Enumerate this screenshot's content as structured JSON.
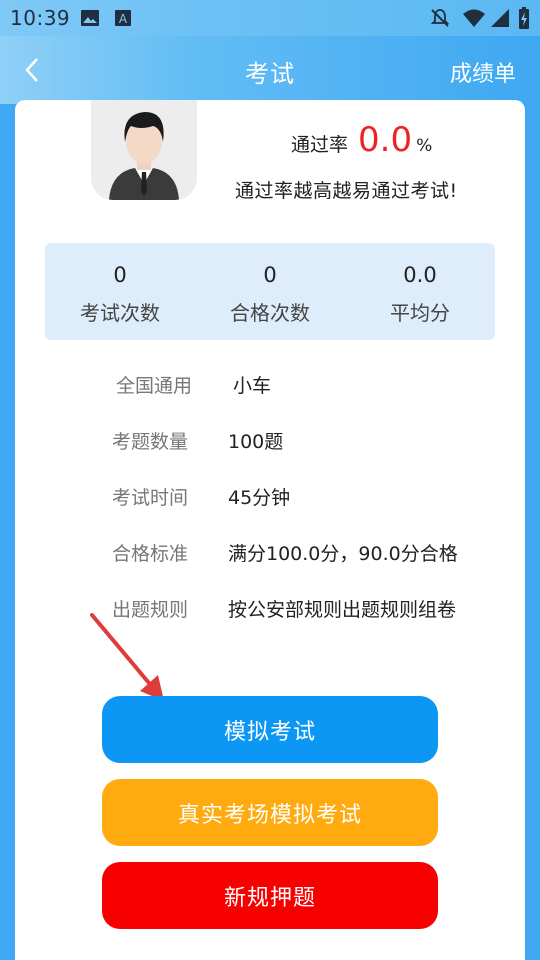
{
  "status_bar": {
    "time": "10:39",
    "icons": [
      "image-icon",
      "text-a-icon",
      "mute-bell-icon",
      "wifi-icon",
      "signal-icon",
      "battery-charging-icon"
    ]
  },
  "header": {
    "back_icon": "chevron-left-icon",
    "title": "考试",
    "right_label": "成绩单"
  },
  "profile": {
    "avatar_icon": "user-avatar",
    "pass_rate_label": "通过率",
    "pass_rate_value": "0.0",
    "pass_rate_unit": "%",
    "hint": "通过率越高越易通过考试!"
  },
  "stats": [
    {
      "value": "0",
      "label": "考试次数"
    },
    {
      "value": "0",
      "label": "合格次数"
    },
    {
      "value": "0.0",
      "label": "平均分"
    }
  ],
  "info": [
    {
      "key": "全国通用",
      "value": "小车"
    },
    {
      "key": "考题数量",
      "value": "100题"
    },
    {
      "key": "考试时间",
      "value": "45分钟"
    },
    {
      "key": "合格标准",
      "value": "满分100.0分，90.0分合格"
    },
    {
      "key": "出题规则",
      "value": "按公安部规则出题规则组卷"
    }
  ],
  "buttons": {
    "mock_exam": "模拟考试",
    "real_exam": "真实考场模拟考试",
    "new_rules": "新规押题"
  },
  "colors": {
    "header_blue": "#3ea8f2",
    "pass_rate_red": "#ee2222",
    "btn_blue": "#0d97f5",
    "btn_orange": "#ffab0f",
    "btn_red": "#f70000",
    "stats_bg": "#deedfb"
  }
}
